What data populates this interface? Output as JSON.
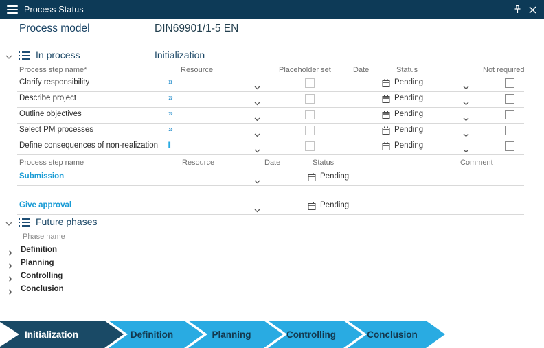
{
  "title_bar": {
    "title": "Process Status"
  },
  "header": {
    "label": "Process model",
    "value": "DIN69901/1-5 EN"
  },
  "in_process": {
    "title": "In process",
    "phase": "Initialization",
    "columns": [
      "Process step name*",
      "Resource",
      "Placeholder set",
      "Date",
      "Status",
      "Not required"
    ],
    "rows": [
      {
        "name": "Clarify responsibility",
        "resource": "»",
        "status": "Pending"
      },
      {
        "name": "Describe project",
        "resource": "»",
        "status": "Pending"
      },
      {
        "name": "Outline objectives",
        "resource": "»",
        "status": "Pending"
      },
      {
        "name": "Select PM processes",
        "resource": "»",
        "status": "Pending"
      },
      {
        "name": "Define consequences of non-realization",
        "resource": "I",
        "status": "Pending"
      }
    ]
  },
  "approval": {
    "columns": [
      "Process step name",
      "Resource",
      "Date",
      "Status",
      "Comment"
    ],
    "rows": [
      {
        "name": "Submission",
        "status": "Pending"
      },
      {
        "name": "Give approval",
        "status": "Pending"
      }
    ]
  },
  "future_phases": {
    "title": "Future phases",
    "column": "Phase name",
    "rows": [
      "Definition",
      "Planning",
      "Controlling",
      "Conclusion"
    ]
  },
  "phase_bar": {
    "active": "Initialization",
    "phases": [
      "Initialization",
      "Definition",
      "Planning",
      "Controlling",
      "Conclusion"
    ]
  },
  "colors": {
    "accent_dark": "#0d3a57",
    "accent_cyan": "#29abe2"
  }
}
